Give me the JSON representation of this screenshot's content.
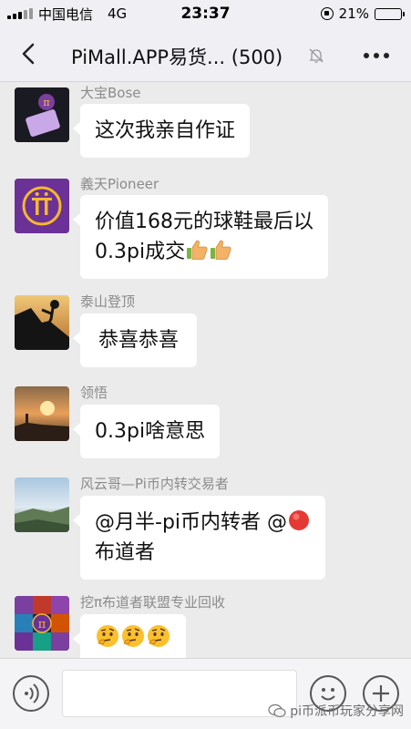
{
  "status_bar": {
    "carrier": "中国电信",
    "network": "4G",
    "time": "23:37",
    "battery_percent": "21%",
    "battery_level": 0.21
  },
  "header": {
    "title": "PiMall.APP易货... (500)",
    "icons": [
      "back-icon",
      "mute-bell-icon",
      "more-icon"
    ]
  },
  "messages": [
    {
      "sender": "大宝Bose",
      "lines": [
        "这次我亲自作证"
      ],
      "emoji": [],
      "avatar": "dark-photo"
    },
    {
      "sender": "義天Pioneer",
      "lines": [
        "价值168元的球鞋最后以",
        "0.3pi成交"
      ],
      "emoji": [
        "thumbs-up",
        "thumbs-up"
      ],
      "avatar": "pi-logo"
    },
    {
      "sender": "泰山登顶",
      "lines": [
        "恭喜恭喜"
      ],
      "emoji": [],
      "avatar": "climber-silhouette"
    },
    {
      "sender": "领悟",
      "lines": [
        "0.3pi啥意思"
      ],
      "emoji": [],
      "avatar": "sunset"
    },
    {
      "sender": "风云哥—Pi币内转交易者",
      "lines": [
        "@月半-pi币内转者 @",
        "布道者"
      ],
      "emoji": [
        "red-circle"
      ],
      "avatar": "landscape"
    },
    {
      "sender": "挖π布道者联盟专业回收",
      "lines": [
        ""
      ],
      "emoji": [
        "thinking-face",
        "thinking-face",
        "thinking-face"
      ],
      "avatar": "pi-collage"
    }
  ],
  "input_bar": {
    "icons": [
      "voice-icon",
      "emoji-icon",
      "plus-icon"
    ],
    "input_value": ""
  },
  "watermark": "pi币派币玩家分享网",
  "colors": {
    "chat_background": "#ebebeb",
    "bar_background": "#efeff4",
    "bubble": "#ffffff",
    "sender_text": "#8b8b8b"
  }
}
